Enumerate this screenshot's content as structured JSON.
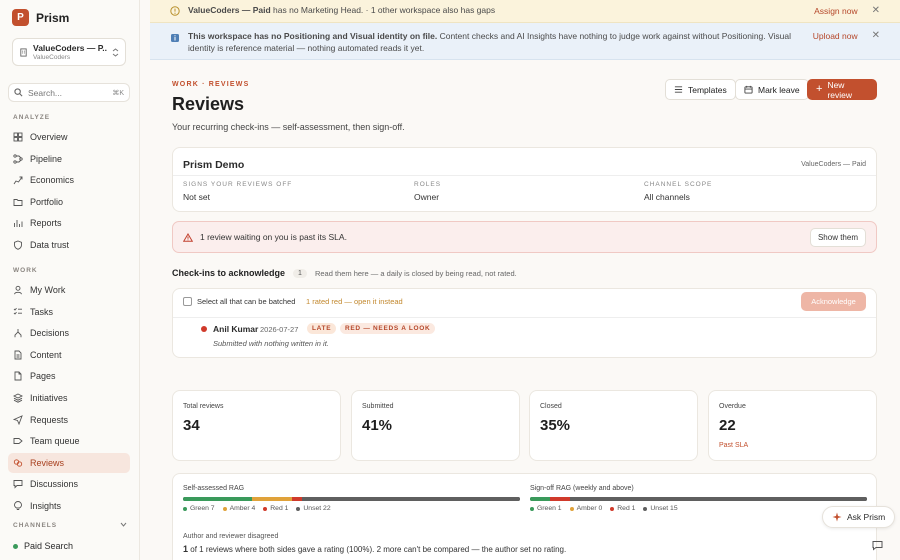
{
  "app": {
    "logo_letter": "P",
    "name": "Prism"
  },
  "workspace": {
    "name": "ValueCoders — P...",
    "sub": "ValueCoders"
  },
  "search": {
    "placeholder": "Search...",
    "shortcut": "⌘K"
  },
  "sidebar": {
    "section_analyze": "ANALYZE",
    "analyze": [
      {
        "label": "Overview",
        "icon": "grid-icon"
      },
      {
        "label": "Pipeline",
        "icon": "pipeline-icon"
      },
      {
        "label": "Economics",
        "icon": "economics-icon"
      },
      {
        "label": "Portfolio",
        "icon": "folder-icon"
      },
      {
        "label": "Reports",
        "icon": "reports-icon"
      },
      {
        "label": "Data trust",
        "icon": "shield-icon"
      }
    ],
    "section_work": "WORK",
    "work": [
      {
        "label": "My Work",
        "icon": "user-icon"
      },
      {
        "label": "Tasks",
        "icon": "tasks-icon"
      },
      {
        "label": "Decisions",
        "icon": "decisions-icon"
      },
      {
        "label": "Content",
        "icon": "document-icon"
      },
      {
        "label": "Pages",
        "icon": "page-icon"
      },
      {
        "label": "Initiatives",
        "icon": "layers-icon"
      },
      {
        "label": "Requests",
        "icon": "send-icon"
      },
      {
        "label": "Team queue",
        "icon": "queue-icon"
      },
      {
        "label": "Reviews",
        "icon": "reviews-icon",
        "active": true
      },
      {
        "label": "Discussions",
        "icon": "chat-icon"
      },
      {
        "label": "Insights",
        "icon": "bulb-icon"
      }
    ],
    "section_channels": "CHANNELS",
    "channel": "Paid Search",
    "channel_color": "#3a9a5b"
  },
  "banners": {
    "gaps": {
      "bold": "ValueCoders — Paid",
      "text": "has no Marketing Head. · 1 other workspace also has gaps",
      "action": "Assign now"
    },
    "positioning": {
      "bold": "This workspace has no Positioning and Visual identity on file.",
      "text": "Content checks and AI Insights have nothing to judge work against without Positioning. Visual identity is reference material — nothing automated reads it yet.",
      "action": "Upload now"
    }
  },
  "header": {
    "breadcrumb": "WORK · REVIEWS",
    "title": "Reviews",
    "subtitle": "Your recurring check-ins — self-assessment, then sign-off.",
    "templates_label": "Templates",
    "mark_leave_label": "Mark leave",
    "new_review_label": "New review"
  },
  "org": {
    "name": "Prism Demo",
    "tag": "ValueCoders — Paid",
    "signs_label": "SIGNS YOUR REVIEWS OFF",
    "signs_value": "Not set",
    "roles_label": "ROLES",
    "roles_value": "Owner",
    "scope_label": "CHANNEL SCOPE",
    "scope_value": "All channels"
  },
  "sla": {
    "text": "1 review waiting on you is past its SLA.",
    "action": "Show them"
  },
  "checkins": {
    "title": "Check-ins to acknowledge",
    "count": "1",
    "note": "Read them here — a daily is closed by being read, not rated.",
    "select_all": "Select all that can be batched",
    "select_note": "1 rated red — open it instead",
    "acknowledge": "Acknowledge",
    "row": {
      "name": "Anil Kumar",
      "date": "2026-07-27",
      "late": "LATE",
      "rag": "RED — NEEDS A LOOK",
      "sub": "Submitted with nothing written in it."
    }
  },
  "stats": [
    {
      "label": "Total reviews",
      "value": "34",
      "sub": ""
    },
    {
      "label": "Submitted",
      "value": "41%",
      "sub": ""
    },
    {
      "label": "Closed",
      "value": "35%",
      "sub": ""
    },
    {
      "label": "Overdue",
      "value": "22",
      "sub": "Past SLA"
    }
  ],
  "rag": {
    "self": {
      "title": "Self-assessed RAG",
      "green": 7,
      "amber": 4,
      "red": 1,
      "unset": 22,
      "green_label": "Green 7",
      "amber_label": "Amber 4",
      "red_label": "Red 1",
      "unset_label": "Unset 22"
    },
    "signoff": {
      "title": "Sign-off RAG (weekly and above)",
      "green": 1,
      "amber": 0,
      "red": 1,
      "unset": 15,
      "green_label": "Green 1",
      "amber_label": "Amber 0",
      "red_label": "Red 1",
      "unset_label": "Unset 15"
    },
    "colors": {
      "green": "#3a9a5b",
      "amber": "#e0a23a",
      "red": "#d03a2b",
      "unset": "#5f5f5f"
    },
    "disagree_label": "Author and reviewer disagreed",
    "disagree_bold": "1",
    "disagree_text": "of 1 reviews where both sides gave a rating (100%). 2 more can't be compared — the author set no rating."
  },
  "assistant": {
    "label": "Ask Prism"
  },
  "colors": {
    "accent": "#c2502e",
    "active_bg": "#f7e6de"
  }
}
